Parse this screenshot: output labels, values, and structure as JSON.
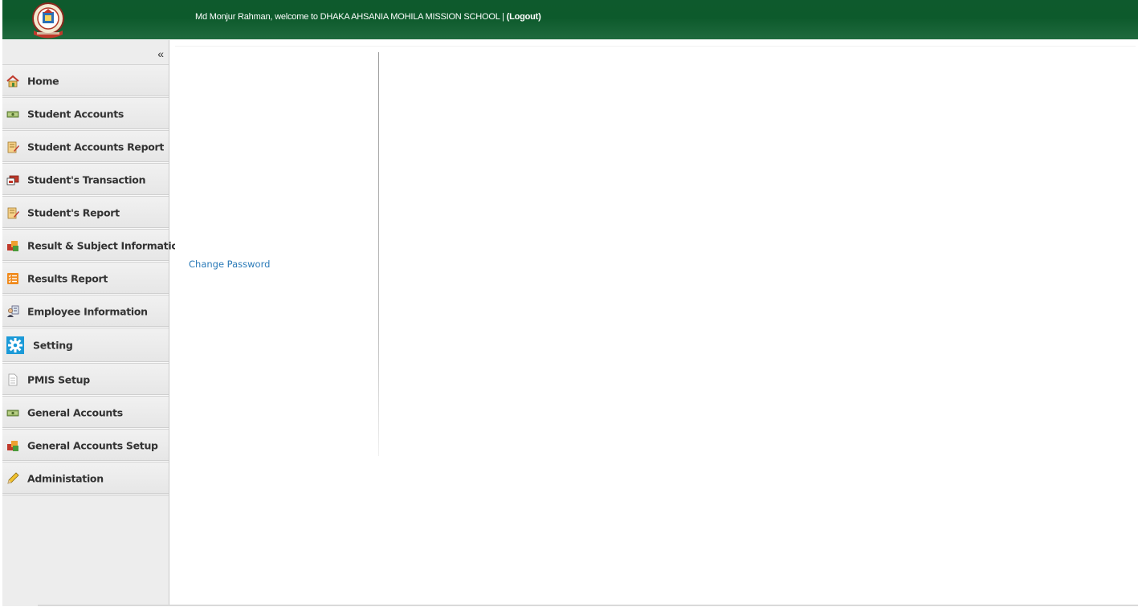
{
  "header": {
    "welcome_text": "Md Monjur Rahman, welcome to DHAKA AHSANIA MOHILA MISSION SCHOOL | ",
    "logout_label": "(Logout)",
    "logo_icon": "school-emblem-logo",
    "colors": {
      "bar": "#0e5a2d",
      "text": "#ffffff"
    }
  },
  "sidebar": {
    "collapse_symbol": "«",
    "items": [
      {
        "label": "Home",
        "icon": "home-icon"
      },
      {
        "label": "Student Accounts",
        "icon": "money-icon"
      },
      {
        "label": "Student Accounts Report",
        "icon": "report-edit-icon"
      },
      {
        "label": "Student's Transaction",
        "icon": "transaction-icon"
      },
      {
        "label": "Student's Report",
        "icon": "report-edit-icon"
      },
      {
        "label": "Result & Subject Information",
        "icon": "boxes-icon"
      },
      {
        "label": "Results Report",
        "icon": "checklist-icon"
      },
      {
        "label": "Employee Information",
        "icon": "employee-icon"
      },
      {
        "label": "Setting",
        "icon": "gear-icon"
      },
      {
        "label": "PMIS Setup",
        "icon": "document-icon"
      },
      {
        "label": "General Accounts",
        "icon": "money-icon"
      },
      {
        "label": "General Accounts Setup",
        "icon": "boxes-icon"
      },
      {
        "label": "Administation",
        "icon": "pencil-icon"
      }
    ]
  },
  "main": {
    "change_password_label": "Change Password",
    "link_color": "#2a7ab8"
  }
}
